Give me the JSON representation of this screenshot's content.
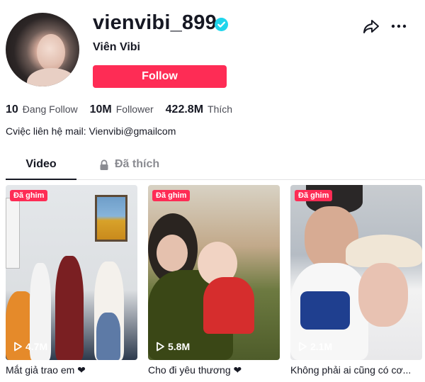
{
  "profile": {
    "username": "vienvibi_899",
    "nickname": "Viên Vibi",
    "follow_label": "Follow",
    "bio": "Cviệc liên hệ mail: Vienvibi@gmailcom"
  },
  "stats": [
    {
      "value": "10",
      "label": "Đang Follow"
    },
    {
      "value": "10M",
      "label": "Follower"
    },
    {
      "value": "422.8M",
      "label": "Thích"
    }
  ],
  "tabs": [
    {
      "label": "Video",
      "active": true
    },
    {
      "label": "Đã thích",
      "active": false
    }
  ],
  "videos": [
    {
      "badge": "Đã ghim",
      "views": "4.7M",
      "caption": "Mắt giả trao em ❤"
    },
    {
      "badge": "Đã ghim",
      "views": "5.8M",
      "caption": "Cho đi yêu thương ❤"
    },
    {
      "badge": "Đã ghim",
      "views": "2.1M",
      "caption": "Không phải ai cũng có cơ..."
    }
  ],
  "icons": {
    "verified": "verified-badge-icon",
    "share": "share-arrow-icon",
    "more": "more-dots-icon",
    "lock": "lock-icon",
    "play": "play-icon"
  },
  "colors": {
    "accent": "#fe2c55",
    "verified": "#20d5ec",
    "text": "#161823",
    "muted": "#8a8b91"
  }
}
